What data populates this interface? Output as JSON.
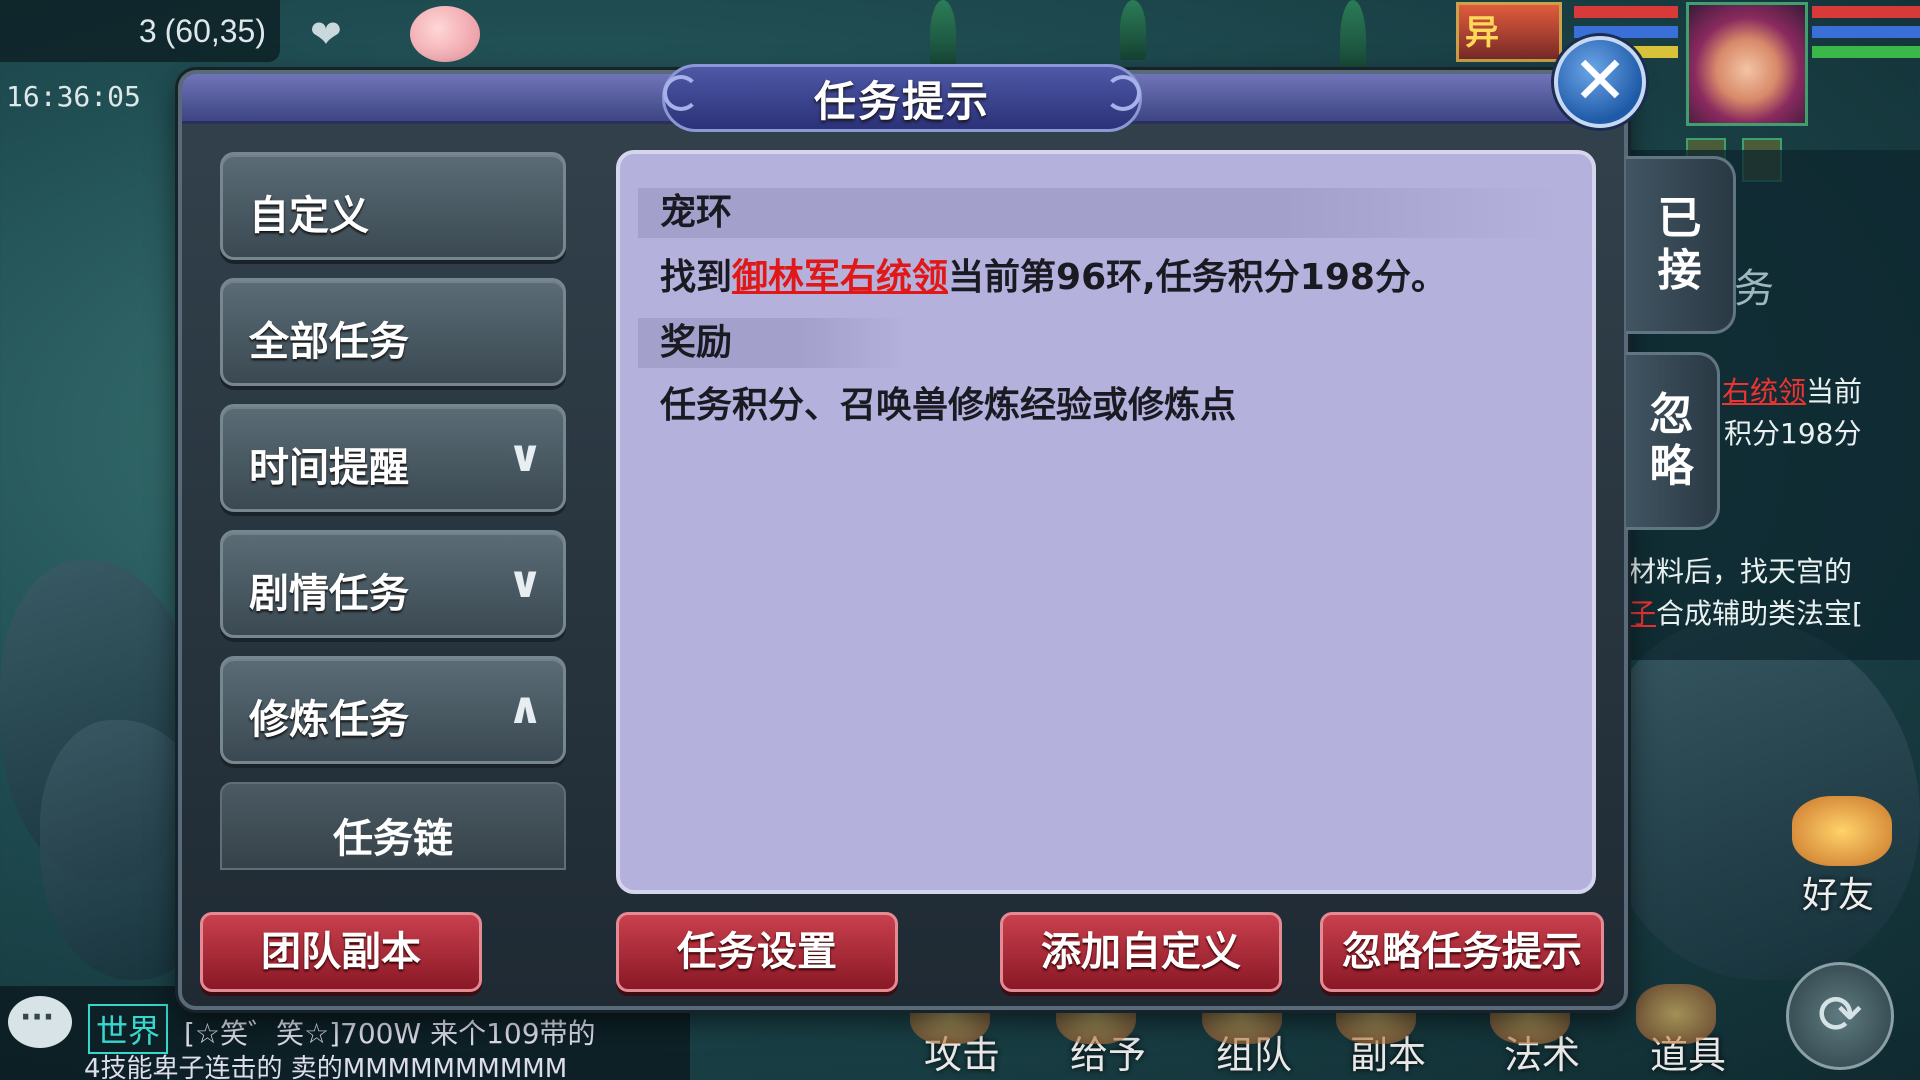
{
  "hud": {
    "coords": "(60,35)",
    "coords_prefix": "3",
    "time": "16:36:05",
    "portrait_small_label": "异"
  },
  "dialog": {
    "title": "任务提示",
    "close_glyph": "✕",
    "nav": [
      {
        "label": "自定义",
        "chevron": ""
      },
      {
        "label": "全部任务",
        "chevron": ""
      },
      {
        "label": "时间提醒",
        "chevron": "∨"
      },
      {
        "label": "剧情任务",
        "chevron": "∨"
      },
      {
        "label": "修炼任务",
        "chevron": "∧"
      }
    ],
    "nav_sub": {
      "label": "任务链"
    },
    "content": {
      "section1_title": "宠环",
      "section1_prefix": "找到",
      "section1_npc": "御林军右统领",
      "section1_suffix": "当前第96环,任务积分198分。",
      "section2_title": "奖励",
      "section2_text": "任务积分、召唤兽修炼经验或修炼点"
    },
    "side_tabs": [
      {
        "line1": "已",
        "line2": "接"
      },
      {
        "line1": "忽",
        "line2": "略"
      }
    ],
    "footer_buttons": [
      {
        "label": "团队副本"
      },
      {
        "label": "任务设置"
      },
      {
        "label": "添加自定义"
      },
      {
        "label": "忽略任务提示"
      }
    ]
  },
  "side_panel": {
    "line_a_red": "右统领",
    "line_a_tail": "当前",
    "line_b": "积分198分",
    "line_c": "材料后，找天宫的",
    "line_d_red": "子",
    "line_d_tail": "合成辅助类法宝[",
    "fragment": "务"
  },
  "chat": {
    "channel": "世界",
    "line1": "[☆笑゛笑☆]700W  来个109带的",
    "line2": "4技能卑子连击的  卖的MMMMMMMMMM"
  },
  "bottom_actions": [
    "攻击",
    "给予",
    "组队",
    "副本",
    "法术",
    "道具"
  ],
  "friend_button": {
    "label": "好友"
  },
  "refresh_glyph": "⟳"
}
